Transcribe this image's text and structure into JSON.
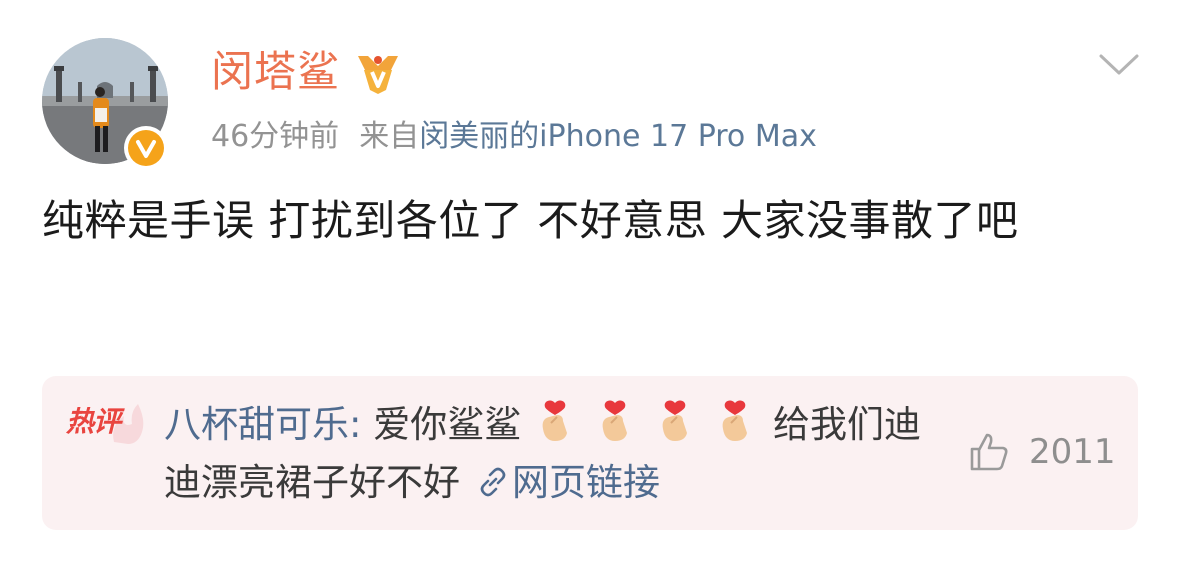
{
  "post": {
    "username": "闵塔鲨",
    "timestamp": "46分钟前",
    "source_prefix": "来自",
    "device": "闵美丽的iPhone 17 Pro Max",
    "text": "纯粹是手误 打扰到各位了 不好意思 大家没事散了吧",
    "icons": {
      "vip_badge": "vip-crown-badge-icon",
      "verified": "verified-v-icon",
      "menu": "chevron-down-icon"
    }
  },
  "hot_comment": {
    "tag": "热评",
    "commenter": "八杯甜可乐",
    "separator": ":",
    "text_before_emoji": "爱你鲨鲨",
    "emoji_count": 4,
    "emoji_name": "finger-heart-emoji",
    "text_after_emoji": "给我们迪迪漂亮裙子好不好",
    "link_label": "网页链接",
    "like_count": "2011"
  },
  "colors": {
    "username": "#eb7350",
    "meta": "#939393",
    "link": "#4f6b8f",
    "hot_box_bg": "#fbf1f2",
    "hot_tag": "#e9443f",
    "verified": "#f5a31a"
  }
}
